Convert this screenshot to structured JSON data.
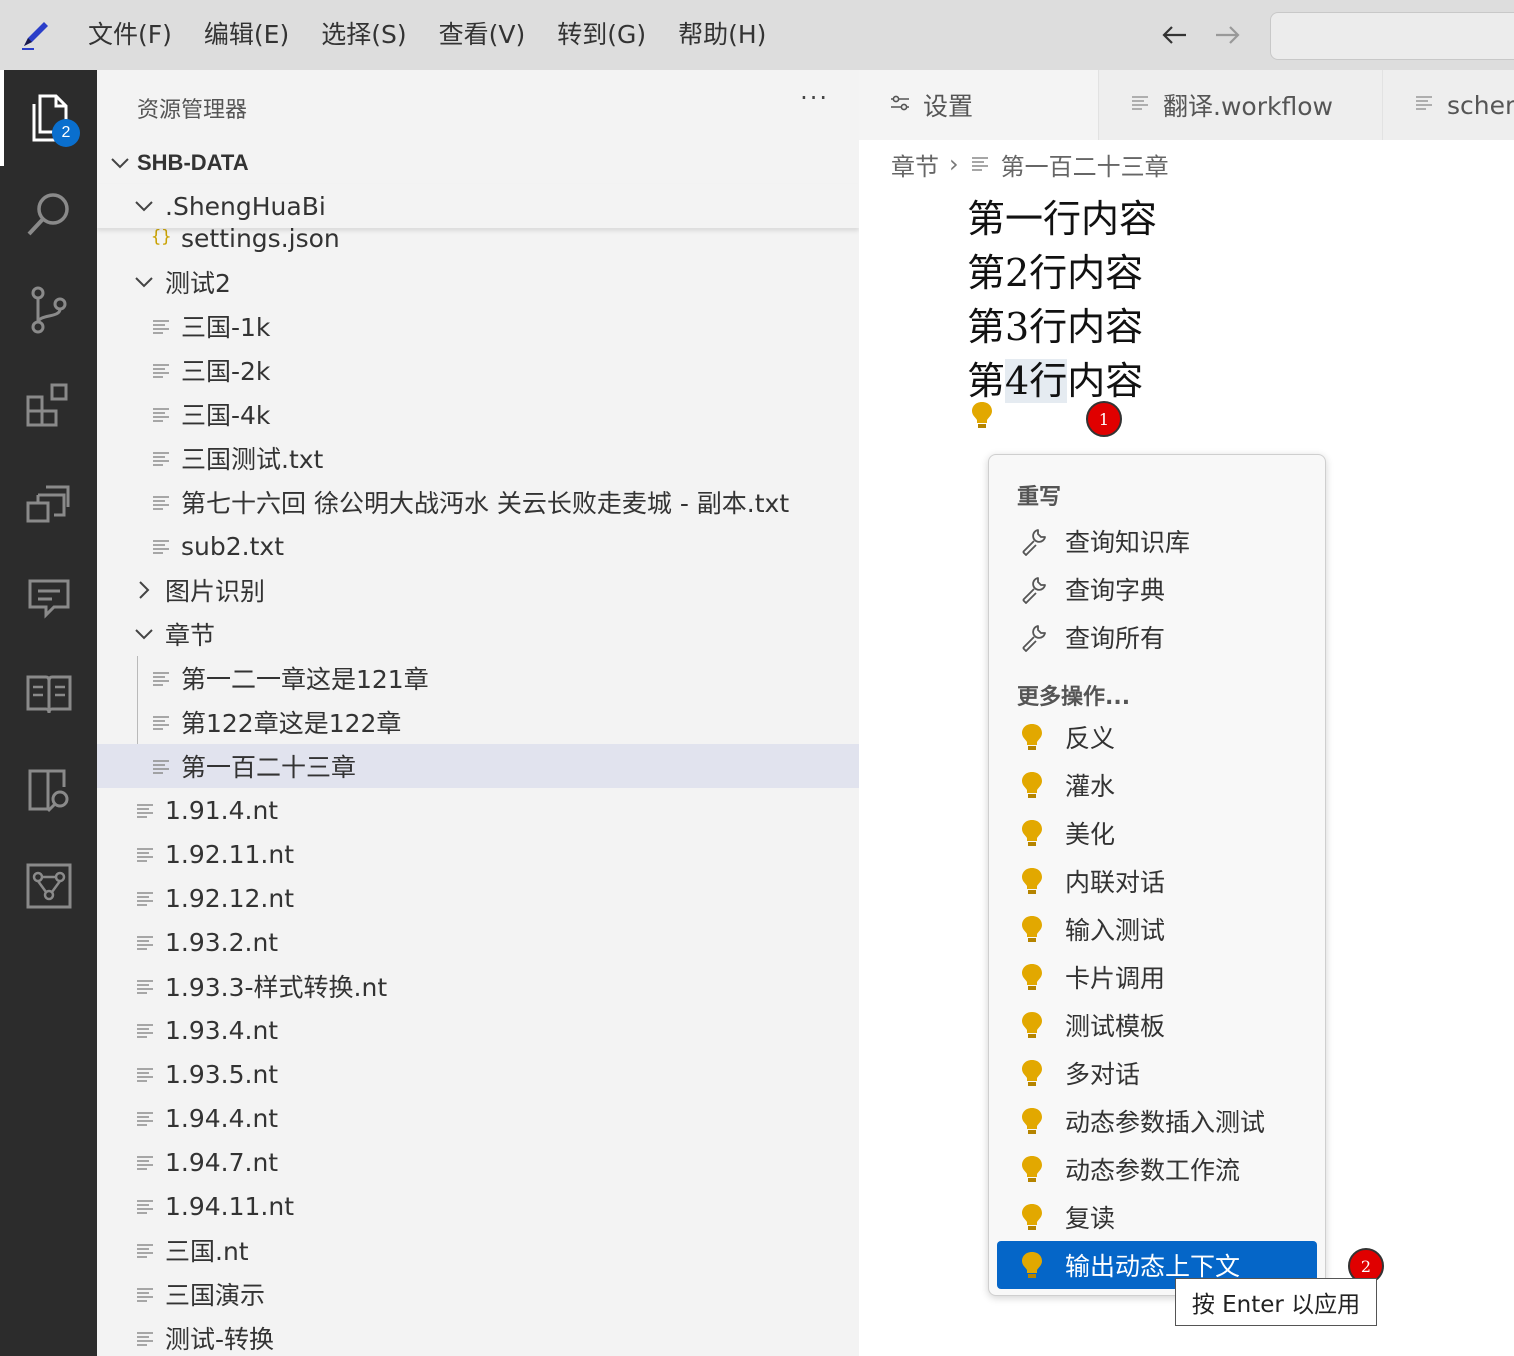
{
  "menu": {
    "items": [
      "文件(F)",
      "编辑(E)",
      "选择(S)",
      "查看(V)",
      "转到(G)",
      "帮助(H)"
    ]
  },
  "activity_bar": {
    "explorer_badge": "2",
    "icons": [
      "files-icon",
      "search-icon",
      "source-control-icon",
      "extensions-icon",
      "remote-icon",
      "chat-icon",
      "book-icon",
      "search-book-icon",
      "workflow-icon"
    ]
  },
  "explorer": {
    "title": "资源管理器",
    "more": "···",
    "root": "SHB-DATA",
    "tree": [
      {
        "label": ".ShengHuaBi",
        "type": "folder-open",
        "depth": 1
      },
      {
        "label": "settings.json",
        "type": "json",
        "depth": 2
      },
      {
        "label": "测试2",
        "type": "folder-open",
        "depth": 1
      },
      {
        "label": "三国-1k",
        "type": "file",
        "depth": 2
      },
      {
        "label": "三国-2k",
        "type": "file",
        "depth": 2
      },
      {
        "label": "三国-4k",
        "type": "file",
        "depth": 2
      },
      {
        "label": "三国测试.txt",
        "type": "file",
        "depth": 2
      },
      {
        "label": "第七十六回 徐公明大战沔水 关云长败走麦城 - 副本.txt",
        "type": "file",
        "depth": 2
      },
      {
        "label": "sub2.txt",
        "type": "file",
        "depth": 2
      },
      {
        "label": "图片识别",
        "type": "folder-closed",
        "depth": 1
      },
      {
        "label": "章节",
        "type": "folder-open",
        "depth": 1
      },
      {
        "label": "第一二一章这是121章",
        "type": "file",
        "depth": 2
      },
      {
        "label": "第122章这是122章",
        "type": "file",
        "depth": 2
      },
      {
        "label": "第一百二十三章",
        "type": "file",
        "depth": 2,
        "selected": true
      },
      {
        "label": "1.91.4.nt",
        "type": "file",
        "depth": 1
      },
      {
        "label": "1.92.11.nt",
        "type": "file",
        "depth": 1
      },
      {
        "label": "1.92.12.nt",
        "type": "file",
        "depth": 1
      },
      {
        "label": "1.93.2.nt",
        "type": "file",
        "depth": 1
      },
      {
        "label": "1.93.3-样式转换.nt",
        "type": "file",
        "depth": 1
      },
      {
        "label": "1.93.4.nt",
        "type": "file",
        "depth": 1
      },
      {
        "label": "1.93.5.nt",
        "type": "file",
        "depth": 1
      },
      {
        "label": "1.94.4.nt",
        "type": "file",
        "depth": 1
      },
      {
        "label": "1.94.7.nt",
        "type": "file",
        "depth": 1
      },
      {
        "label": "1.94.11.nt",
        "type": "file",
        "depth": 1
      },
      {
        "label": "三国.nt",
        "type": "file",
        "depth": 1
      },
      {
        "label": "三国演示",
        "type": "file",
        "depth": 1
      },
      {
        "label": "测试-转换",
        "type": "file",
        "depth": 1
      }
    ]
  },
  "tabs": [
    {
      "label": "设置",
      "icon": "settings-sliders-icon",
      "active": true
    },
    {
      "label": "翻译.workflow",
      "icon": "file-lines-icon",
      "active": false
    },
    {
      "label": "schem",
      "icon": "file-lines-icon",
      "active": false
    }
  ],
  "breadcrumb": {
    "folder": "章节",
    "file": "第一百二十三章"
  },
  "editor": {
    "lines": [
      {
        "pre": "第一行内容",
        "hl": "",
        "post": ""
      },
      {
        "pre": "第2行内容",
        "hl": "",
        "post": ""
      },
      {
        "pre": "第3行内容",
        "hl": "",
        "post": ""
      },
      {
        "pre": "第",
        "hl": "4行",
        "post": "内容"
      }
    ]
  },
  "markers": [
    "1",
    "2"
  ],
  "quickfix": {
    "section_rewrite": "重写",
    "rewrite_items": [
      "查询知识库",
      "查询字典",
      "查询所有"
    ],
    "section_more": "更多操作...",
    "more_items": [
      "反义",
      "灌水",
      "美化",
      "内联对话",
      "输入测试",
      "卡片调用",
      "测试模板",
      "多对话",
      "动态参数插入测试",
      "动态参数工作流",
      "复读",
      "输出动态上下文"
    ],
    "focused_item": "输出动态上下文",
    "hint": "按 Enter 以应用"
  },
  "colors": {
    "activity_bg": "#2c2c2c",
    "accent_blue": "#0566c8",
    "bulb": "#e2a800",
    "marker_red": "#e00000"
  }
}
